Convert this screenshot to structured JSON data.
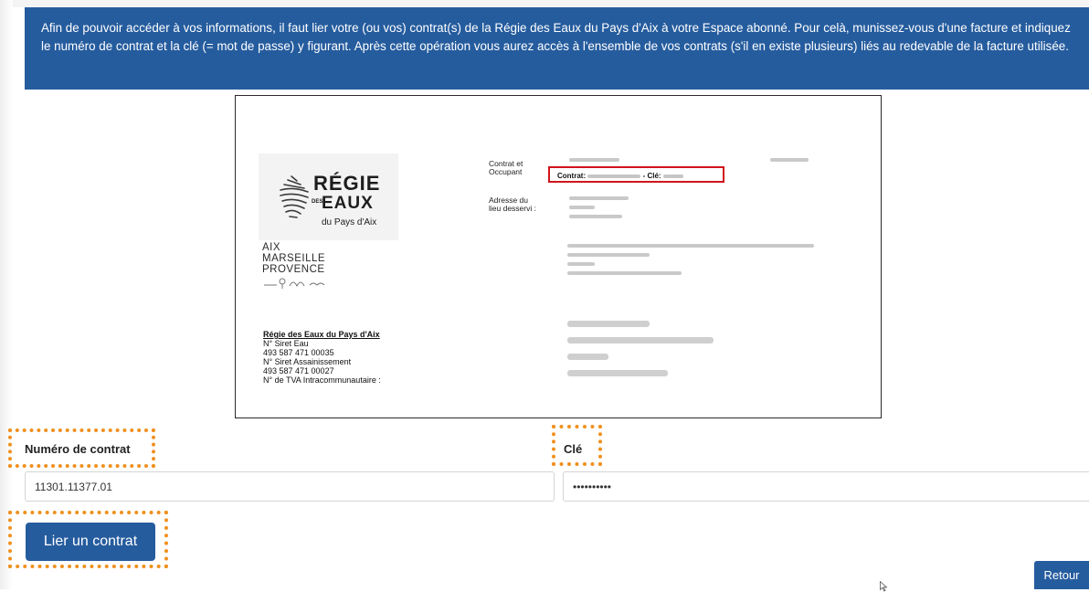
{
  "banner": {
    "text": "Afin de pouvoir accéder à vos informations, il faut lier votre (ou vos) contrat(s) de la Régie des Eaux du Pays d'Aix à votre Espace abonné. Pour celà, munissez-vous d'une facture et indiquez le numéro de contrat et la clé (= mot de passe) y figurant. Après cette opération vous aurez accès à l'ensemble de vos contrats (s'il en existe plusieurs) liés au redevable de la facture utilisée."
  },
  "invoice": {
    "logo": {
      "regie": "RÉGIE",
      "des": "DES",
      "eaux": "EAUX",
      "pays": "du Pays d'Aix"
    },
    "metropole": {
      "line1": "AIX",
      "line2": "MARSEILLE",
      "line3": "PROVENCE"
    },
    "contrat_label": [
      "Contrat et",
      "Occupant"
    ],
    "adresse_label": [
      "Adresse du",
      "lieu desservi :"
    ],
    "highlight": {
      "contrat": "Contrat:",
      "cle": "- Clé:"
    },
    "issuer": {
      "name": "Régie des Eaux du Pays d'Aix",
      "siret_eau_label": "N° Siret Eau",
      "siret_eau": "493 587 471 00035",
      "siret_assain_label": "N° Siret Assainissement",
      "siret_assain": "493 587 471 00027",
      "tva_label": "N° de TVA Intracommunautaire :"
    }
  },
  "form": {
    "contract_label": "Numéro de contrat",
    "contract_value": "11301.11377.01",
    "key_label": "Clé",
    "key_value": "••••••••••",
    "submit_label": "Lier un contrat",
    "back_label": "Retour"
  },
  "colors": {
    "primary": "#255c9e",
    "highlight": "#f0901e",
    "invoice_mark": "#d1141b"
  },
  "icons": {
    "cursor": "mouse-pointer-icon"
  }
}
